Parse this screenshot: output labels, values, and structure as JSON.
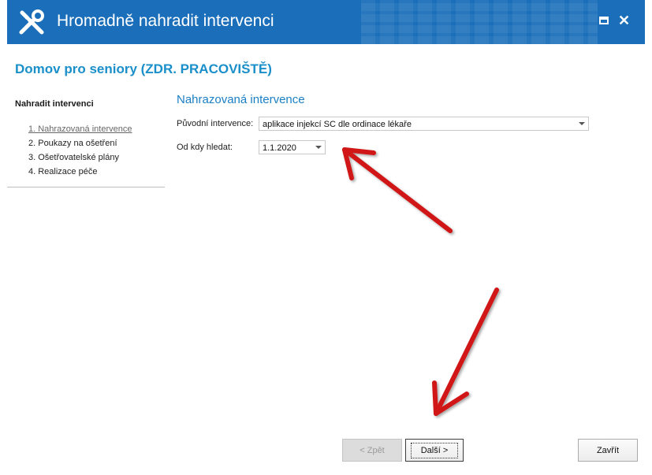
{
  "window": {
    "title": "Hromadně nahradit intervenci",
    "icon": "tools-icon",
    "maximize_icon": "maximize-icon",
    "close_icon": "close-icon",
    "close_glyph": "✕"
  },
  "org": {
    "title": "Domov pro seniory (ZDR. PRACOVIŠTĚ)"
  },
  "sidebar": {
    "heading": "Nahradit intervenci",
    "steps": [
      {
        "label": "1. Nahrazovaná intervence",
        "active": true
      },
      {
        "label": "2. Poukazy na ošetření"
      },
      {
        "label": "3. Ošetřovatelské plány"
      },
      {
        "label": "4. Realizace péče"
      }
    ]
  },
  "form": {
    "section_title": "Nahrazovaná intervence",
    "original_label": "Původní intervence:",
    "original_value": "aplikace injekcí SC dle ordinace lékaře",
    "from_label": "Od kdy hledat:",
    "from_value": "1.1.2020"
  },
  "buttons": {
    "back": "< Zpět",
    "next": "Další >",
    "close": "Zavřít"
  },
  "colors": {
    "titlebar": "#1b6fba",
    "accent": "#1a8fc9",
    "annotation_arrow": "#d01515"
  }
}
